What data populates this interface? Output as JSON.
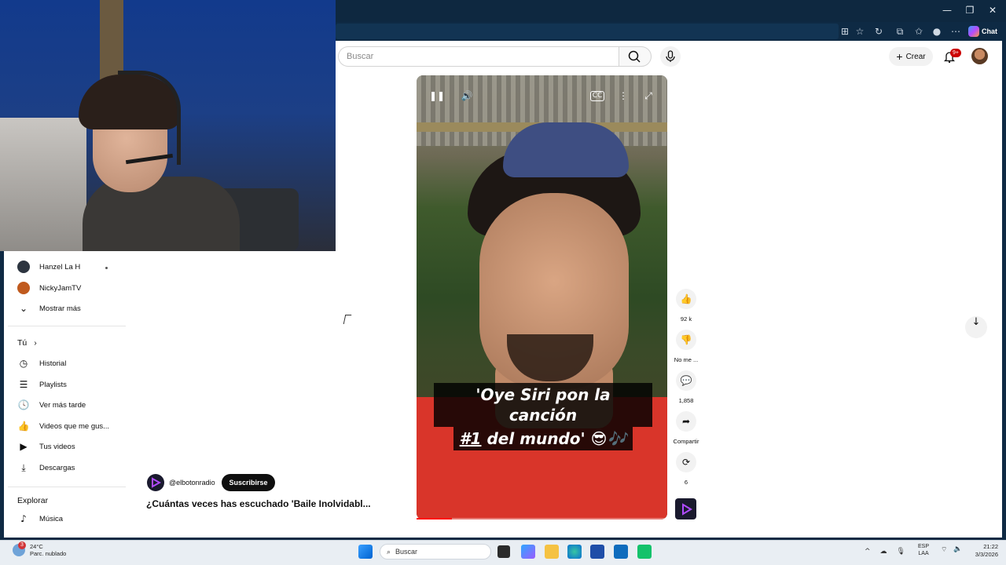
{
  "browser": {
    "chat_label": "Chat",
    "window_controls": [
      "minimize-icon",
      "maximize-icon",
      "close-icon"
    ]
  },
  "header": {
    "search_placeholder": "Buscar",
    "create_label": "Crear",
    "notifications_badge": "9+"
  },
  "sidebar": {
    "subscriptions": [
      {
        "name": "Hanzel La H",
        "color": "#2d3540"
      },
      {
        "name": "NickyJamTV",
        "color": "#c05a1e"
      }
    ],
    "show_more": "Mostrar más",
    "you_heading": "Tú",
    "you_items": [
      {
        "label": "Historial",
        "icon": "history-icon"
      },
      {
        "label": "Playlists",
        "icon": "playlists-icon"
      },
      {
        "label": "Ver más tarde",
        "icon": "watch-later-icon"
      },
      {
        "label": "Videos que me gus...",
        "icon": "liked-videos-icon"
      },
      {
        "label": "Tus videos",
        "icon": "your-videos-icon"
      },
      {
        "label": "Descargas",
        "icon": "downloads-icon"
      }
    ],
    "explore_heading": "Explorar",
    "explore_items": [
      {
        "label": "Música",
        "icon": "music-icon"
      }
    ]
  },
  "short": {
    "channel": "@elbotonradio",
    "subscribe_label": "Suscribirse",
    "title": "¿Cuántas veces has escuchado 'Baile Inolvidabl...",
    "caption_line1": "'Oye Siri pon la canción",
    "caption_line2_hash": "#1",
    "caption_line2_rest": " del mundo' 😎🎶",
    "progress": 0.14
  },
  "actions": {
    "likes": "92 k",
    "dislike_label": "No me ...",
    "comments": "1,858",
    "share_label": "Compartir",
    "remix_count": "6"
  },
  "taskbar": {
    "weather_temp": "24°C",
    "weather_desc": "Parc. nublado",
    "weather_badge": "3",
    "search_label": "Buscar",
    "lang_line1": "ESP",
    "lang_line2": "LAA",
    "time": "21:22",
    "date": "3/3/2026"
  }
}
